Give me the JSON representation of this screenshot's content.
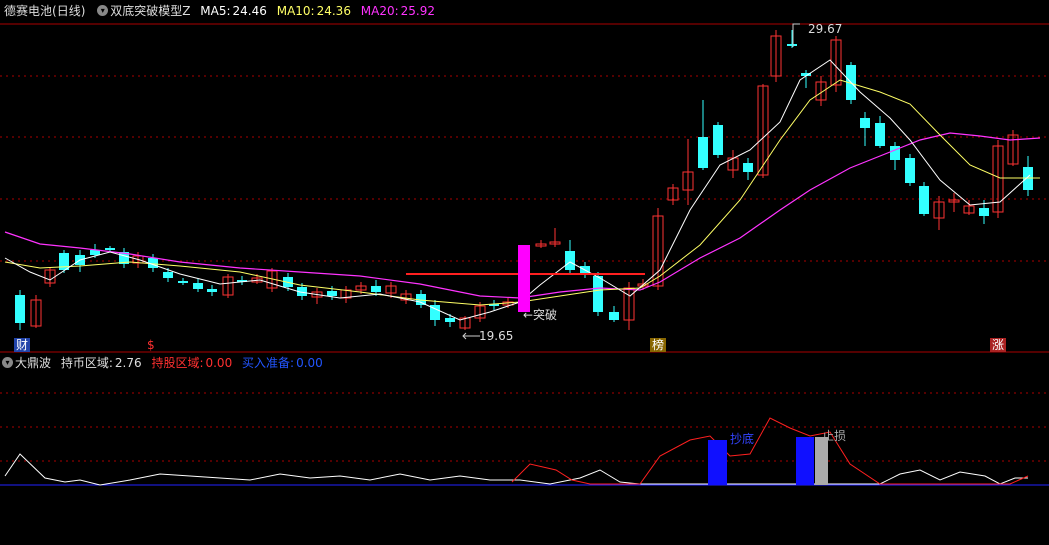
{
  "top_panel": {
    "stock": "德赛电池",
    "period": "(日线)",
    "indicator": "双底突破模型Z",
    "ma5_label": "MA5:",
    "ma5_value": "24.46",
    "ma10_label": "MA10:",
    "ma10_value": "24.36",
    "ma20_label": "MA20:",
    "ma20_value": "25.92",
    "colors": {
      "ma5": "#ffffff",
      "ma10": "#ffff66",
      "ma20": "#ff33ff",
      "up": "#ff3333",
      "down": "#33ffff"
    }
  },
  "annotations": {
    "high": "29.67",
    "low": "19.65",
    "breakout": "←突破"
  },
  "markers": [
    "财",
    "$",
    "榜",
    "涨"
  ],
  "bottom_panel": {
    "indicator": "大鼎波",
    "hold_coin_label": "持币区域:",
    "hold_coin_value": "2.76",
    "hold_stock_label": "持股区域:",
    "hold_stock_value": "0.00",
    "buy_ready_label": "买入准备:",
    "buy_ready_value": "0.00",
    "buy_label": "抄底",
    "stop_label": "止损"
  }
}
